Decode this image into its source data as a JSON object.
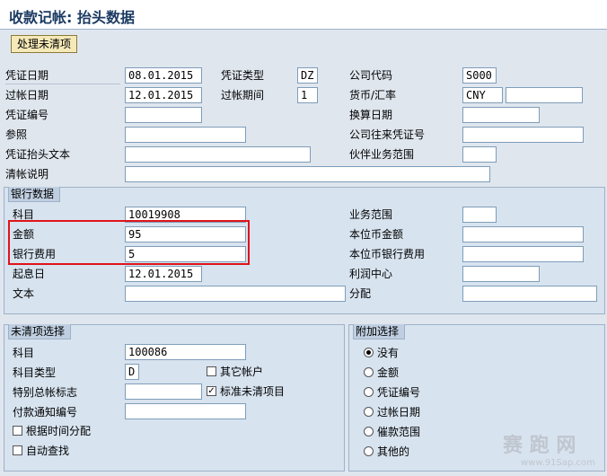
{
  "window": {
    "title": "收款记帐: 抬头数据"
  },
  "toolbar": {
    "process_open_items": "处理未清项"
  },
  "header": {
    "doc_date": {
      "label": "凭证日期",
      "value": "08.01.2015"
    },
    "doc_type": {
      "label": "凭证类型",
      "value": "DZ"
    },
    "company_code": {
      "label": "公司代码",
      "value": "S000"
    },
    "posting_date": {
      "label": "过帐日期",
      "value": "12.01.2015"
    },
    "period": {
      "label": "过帐期间",
      "value": "1"
    },
    "currency_rate": {
      "label": "货币/汇率",
      "value": "CNY",
      "rate": ""
    },
    "doc_number": {
      "label": "凭证编号",
      "value": ""
    },
    "translation_date": {
      "label": "换算日期",
      "value": ""
    },
    "reference": {
      "label": "参照",
      "value": ""
    },
    "cross_cc_doc": {
      "label": "公司往来凭证号",
      "value": ""
    },
    "header_text": {
      "label": "凭证抬头文本",
      "value": ""
    },
    "trading_partner": {
      "label": "伙伴业务范围",
      "value": ""
    },
    "clearing_text": {
      "label": "清帐说明",
      "value": ""
    }
  },
  "bank": {
    "title": "银行数据",
    "account": {
      "label": "科目",
      "value": "10019908"
    },
    "business_area": {
      "label": "业务范围",
      "value": ""
    },
    "amount": {
      "label": "金额",
      "value": "95"
    },
    "lc_amount": {
      "label": "本位币金额",
      "value": ""
    },
    "bank_charges": {
      "label": "银行费用",
      "value": "5"
    },
    "lc_bank_charges": {
      "label": "本位币银行费用",
      "value": ""
    },
    "value_date": {
      "label": "起息日",
      "value": "12.01.2015"
    },
    "profit_center": {
      "label": "利润中心",
      "value": ""
    },
    "text": {
      "label": "文本",
      "value": ""
    },
    "assignment": {
      "label": "分配",
      "value": ""
    }
  },
  "open_items": {
    "title": "未清项选择",
    "account": {
      "label": "科目",
      "value": "100086"
    },
    "account_type": {
      "label": "科目类型",
      "value": "D"
    },
    "other_accounts": {
      "label": "其它帐户",
      "checked": false
    },
    "special_gl": {
      "label": "特别总帐标志",
      "value": ""
    },
    "standard_oi": {
      "label": "标准未清项目",
      "checked": true
    },
    "payment_advice": {
      "label": "付款通知编号",
      "value": ""
    },
    "distribute_by_age": {
      "label": "根据时间分配",
      "checked": false
    },
    "auto_search": {
      "label": "自动查找",
      "checked": false
    }
  },
  "additional": {
    "title": "附加选择",
    "options": [
      {
        "label": "没有",
        "selected": true
      },
      {
        "label": "金额",
        "selected": false
      },
      {
        "label": "凭证编号",
        "selected": false
      },
      {
        "label": "过帐日期",
        "selected": false
      },
      {
        "label": "催款范围",
        "selected": false
      },
      {
        "label": "其他的",
        "selected": false
      }
    ]
  },
  "watermark": {
    "text": "赛 跑 网",
    "sub": "www.91Sap.com"
  }
}
